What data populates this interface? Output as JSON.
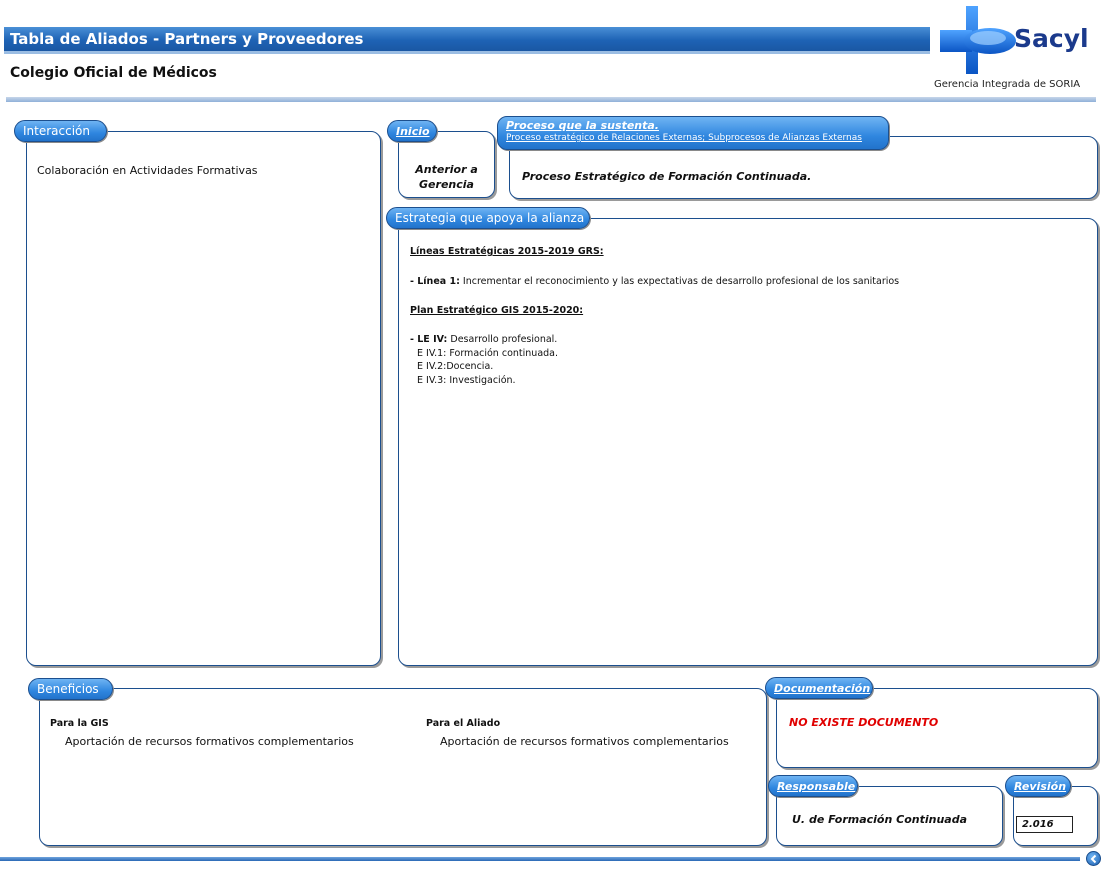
{
  "header": {
    "title": "Tabla de Aliados - Partners y Proveedores",
    "subtitle": "Colegio Oficial de Médicos"
  },
  "logo": {
    "brand": "Sacyl",
    "caption": "Gerencia Integrada de SORIA",
    "icon": "sacyl-cross-logo-icon",
    "color": "#1b6fd0"
  },
  "interaccion": {
    "tab": "Interacción",
    "text": "Colaboración en Actividades Formativas"
  },
  "inicio": {
    "tab": "Inicio",
    "line1": "Anterior a",
    "line2": "Gerencia"
  },
  "proceso": {
    "tab": "Proceso que la sustenta.",
    "tab_sub": "Proceso estratégico de Relaciones Externas; Subprocesos de Alianzas Externas",
    "text": "Proceso Estratégico de Formación Continuada."
  },
  "estrategia": {
    "tab": "Estrategia que apoya la alianza",
    "heading1": "Líneas Estratégicas 2015-2019  GRS:",
    "line1_label": "- Línea 1:",
    "line1_text": " Incrementar el reconocimiento y las expectativas de desarrollo profesional de los sanitarios",
    "heading2": "Plan Estratégico GIS 2015-2020:",
    "le_label": "- LE IV:",
    "le_text": " Desarrollo profesional.",
    "items": [
      "E IV.1: Formación continuada.",
      "E IV.2:Docencia.",
      "E IV.3: Investigación."
    ]
  },
  "beneficios": {
    "tab": "Beneficios",
    "gis_label": "Para la GIS",
    "gis_text": "Aportación de recursos formativos complementarios",
    "aliado_label": "Para el Aliado",
    "aliado_text": "Aportación de recursos formativos complementarios"
  },
  "documentacion": {
    "tab": "Documentación",
    "text": "NO EXISTE DOCUMENTO",
    "text_color": "#e00000"
  },
  "responsable": {
    "tab": "Responsable",
    "text": "U. de Formación Continuada"
  },
  "revision": {
    "tab": "Revisión",
    "value": "2.016"
  },
  "footer": {
    "back_icon": "back-arrow-icon"
  }
}
